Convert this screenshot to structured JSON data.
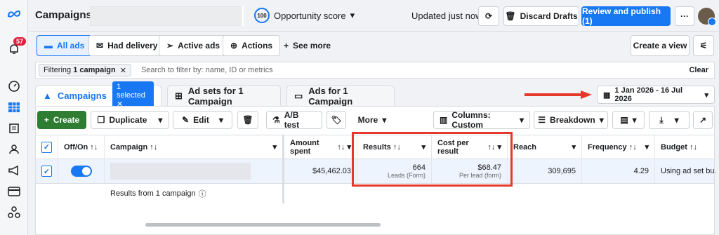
{
  "topbar": {
    "title": "Campaigns",
    "opportunity_value": "100",
    "opportunity_label": "Opportunity score",
    "updated": "Updated just now",
    "discard": "Discard Drafts",
    "review": "Review and publish (1)"
  },
  "leftnav": {
    "notification_count": "57"
  },
  "viewbar": {
    "all_ads": "All ads",
    "had_delivery": "Had delivery",
    "active_ads": "Active ads",
    "actions": "Actions",
    "see_more": "See more",
    "create_view": "Create a view"
  },
  "filter": {
    "chip_prefix": "Filtering ",
    "chip_bold": "1 campaign",
    "placeholder": "Search to filter by: name, ID or metrics",
    "clear": "Clear"
  },
  "tabs": {
    "campaigns": "Campaigns",
    "selected": "1 selected",
    "adsets": "Ad sets for 1 Campaign",
    "ads": "Ads for 1 Campaign"
  },
  "date_range": "1 Jan 2026 - 16 Jul 2026",
  "toolbar": {
    "create": "Create",
    "duplicate": "Duplicate",
    "edit": "Edit",
    "ab_test": "A/B test",
    "more": "More",
    "columns": "Columns: Custom",
    "breakdown": "Breakdown"
  },
  "table": {
    "headers": {
      "offon": "Off/On",
      "campaign": "Campaign",
      "amount_spent": "Amount spent",
      "results": "Results",
      "cost_per_result": "Cost per result",
      "reach": "Reach",
      "frequency": "Frequency",
      "budget": "Budget"
    },
    "row": {
      "amount_spent": "$45,462.03",
      "results": "664",
      "results_sub": "Leads (Form)",
      "cost_per_result": "$68.47",
      "cost_sub": "Per lead (form)",
      "reach": "309,695",
      "frequency": "4.29",
      "budget": "Using ad set bu..."
    },
    "total_label": "Results from 1 campaign"
  },
  "colors": {
    "accent": "#1877f2",
    "highlight": "#e53a2b",
    "create": "#2e7d32"
  }
}
